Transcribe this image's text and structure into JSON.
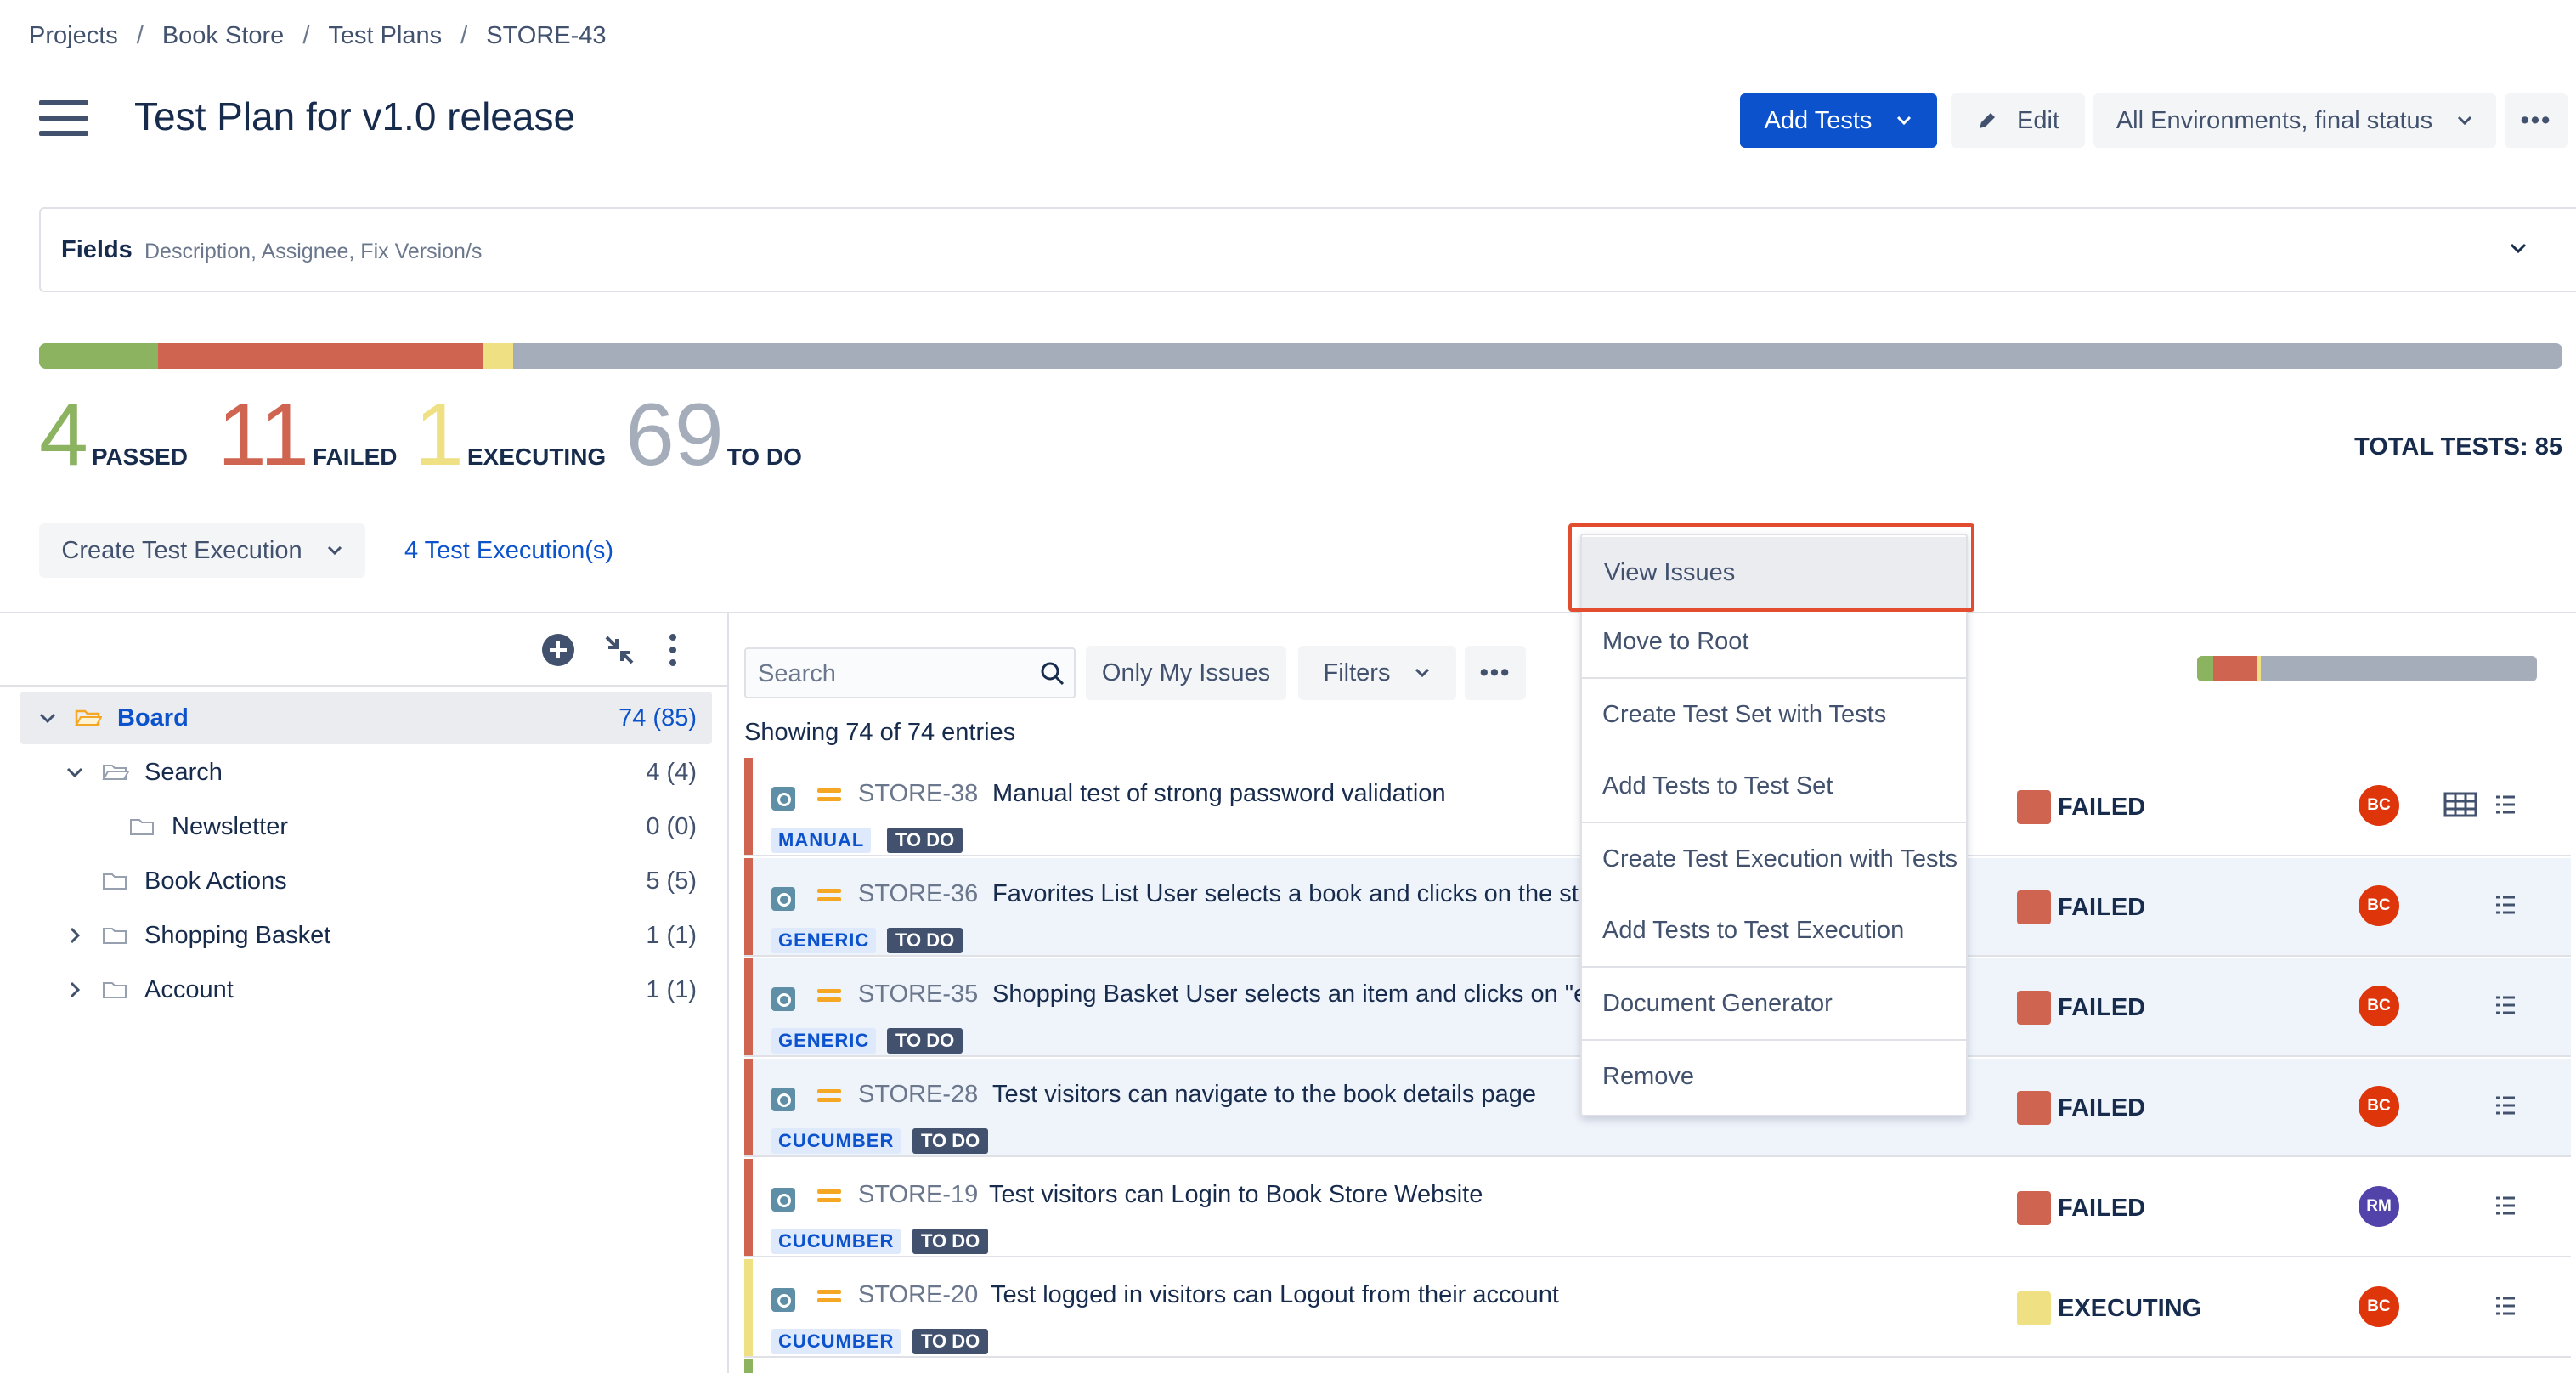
{
  "breadcrumb": [
    "Projects",
    "Book Store",
    "Test Plans",
    "STORE-43"
  ],
  "page": {
    "title": "Test Plan for v1.0 release"
  },
  "header": {
    "add_tests_label": "Add Tests",
    "edit_label": "Edit",
    "environment_label": "All Environments, final status",
    "more_label": "•••"
  },
  "fields": {
    "label": "Fields",
    "sub": "Description, Assignee, Fix Version/s"
  },
  "stats": {
    "passed": {
      "value": "4",
      "label": "PASSED",
      "color": "#8bb360"
    },
    "failed": {
      "value": "11",
      "label": "FAILED",
      "color": "#cf6451"
    },
    "executing": {
      "value": "1",
      "label": "EXECUTING",
      "color": "#efe083"
    },
    "todo": {
      "value": "69",
      "label": "TO DO",
      "color": "#a5adba"
    },
    "total": "TOTAL TESTS: 85",
    "progress_fractions": {
      "passed": 0.047,
      "failed": 0.129,
      "executing": 0.012,
      "todo": 0.812
    }
  },
  "actions": {
    "create_execution_label": "Create Test Execution",
    "executions_link": "4 Test Execution(s)"
  },
  "tree": {
    "items": [
      {
        "name": "Board",
        "count": "74 (85)"
      },
      {
        "name": "Search",
        "count": "4 (4)"
      },
      {
        "name": "Newsletter",
        "count": "0 (0)"
      },
      {
        "name": "Book Actions",
        "count": "5 (5)"
      },
      {
        "name": "Shopping Basket",
        "count": "1 (1)"
      },
      {
        "name": "Account",
        "count": "1 (1)"
      }
    ]
  },
  "toolbar": {
    "search_placeholder": "Search",
    "only_my_issues_label": "Only My Issues",
    "filters_label": "Filters",
    "more_label": "•••",
    "showing": "Showing 74 of 74 entries"
  },
  "tests": [
    {
      "key": "STORE-38",
      "summary": "Manual test of strong password validation",
      "type": "MANUAL",
      "status_tag": "TO DO",
      "result": "FAILED",
      "result_color": "#cf6451",
      "assignee": "BC",
      "assignee_color": "#de350b"
    },
    {
      "key": "STORE-36",
      "summary": "Favorites List User selects a book and clicks on the st",
      "type": "GENERIC",
      "status_tag": "TO DO",
      "result": "FAILED",
      "result_color": "#cf6451",
      "assignee": "BC",
      "assignee_color": "#de350b"
    },
    {
      "key": "STORE-35",
      "summary": "Shopping Basket User selects an item and clicks on \"e",
      "type": "GENERIC",
      "status_tag": "TO DO",
      "result": "FAILED",
      "result_color": "#cf6451",
      "assignee": "BC",
      "assignee_color": "#de350b"
    },
    {
      "key": "STORE-28",
      "summary": "Test visitors can navigate to the book details page",
      "type": "CUCUMBER",
      "status_tag": "TO DO",
      "result": "FAILED",
      "result_color": "#cf6451",
      "assignee": "BC",
      "assignee_color": "#de350b"
    },
    {
      "key": "STORE-19",
      "summary": "Test visitors can Login to Book Store Website",
      "type": "CUCUMBER",
      "status_tag": "TO DO",
      "result": "FAILED",
      "result_color": "#cf6451",
      "assignee": "RM",
      "assignee_color": "#5243aa"
    },
    {
      "key": "STORE-20",
      "summary": "Test logged in visitors can Logout from their account",
      "type": "CUCUMBER",
      "status_tag": "TO DO",
      "result": "EXECUTING",
      "result_color": "#efe083",
      "assignee": "BC",
      "assignee_color": "#de350b"
    }
  ],
  "menu": {
    "items": [
      "View Issues",
      "Move to Root",
      "Create Test Set with Tests",
      "Add Tests to Test Set",
      "Create Test Execution with Tests",
      "Add Tests to Test Execution",
      "Document Generator",
      "Remove"
    ]
  }
}
